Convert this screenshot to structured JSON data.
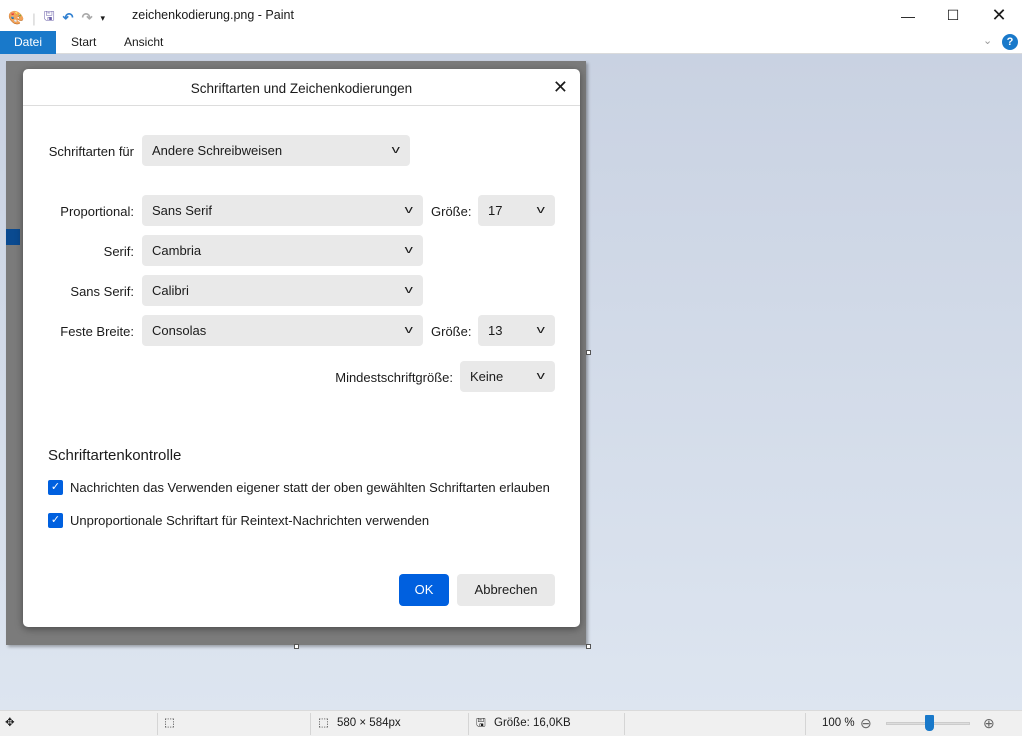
{
  "window": {
    "title": "zeichenkodierung.png - Paint"
  },
  "ribbon": {
    "tabs": [
      "Datei",
      "Start",
      "Ansicht"
    ]
  },
  "dialog": {
    "title": "Schriftarten und Zeichenkodierungen",
    "fonts_for_label": "Schriftarten für",
    "fonts_for_value": "Andere Schreibweisen",
    "proportional_label": "Proportional:",
    "proportional_value": "Sans Serif",
    "size_label": "Größe:",
    "proportional_size": "17",
    "serif_label": "Serif:",
    "serif_value": "Cambria",
    "sans_label": "Sans Serif:",
    "sans_value": "Calibri",
    "mono_label": "Feste Breite:",
    "mono_value": "Consolas",
    "mono_size": "13",
    "min_label": "Mindestschriftgröße:",
    "min_value": "Keine",
    "section": "Schriftartenkontrolle",
    "check1": "Nachrichten das Verwenden eigener statt der oben gewählten Schriftarten erlauben",
    "check2": "Unproportionale Schriftart für Reintext-Nachrichten verwenden",
    "ok": "OK",
    "cancel": "Abbrechen"
  },
  "status": {
    "dimensions": "580 × 584px",
    "size": "Größe: 16,0KB",
    "zoom": "100 %",
    "zoom_percent": 100
  }
}
